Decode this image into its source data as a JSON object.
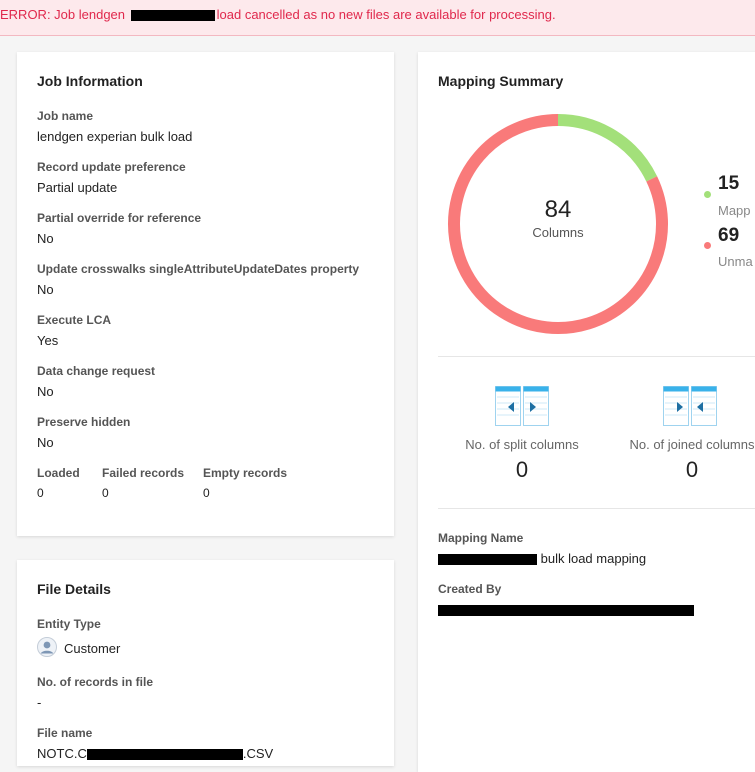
{
  "error": {
    "prefix": "ERROR: Job lendgen",
    "suffix": "load cancelled as no new files are available for processing."
  },
  "job_info": {
    "title": "Job Information",
    "fields": [
      {
        "label": "Job name",
        "value": "lendgen experian bulk load"
      },
      {
        "label": "Record update preference",
        "value": "Partial update"
      },
      {
        "label": "Partial override for reference",
        "value": "No"
      },
      {
        "label": "Update crosswalks singleAttributeUpdateDates property",
        "value": "No"
      },
      {
        "label": "Execute LCA",
        "value": "Yes"
      },
      {
        "label": "Data change request",
        "value": "No"
      },
      {
        "label": "Preserve hidden",
        "value": "No"
      }
    ],
    "counts": [
      {
        "label": "Loaded",
        "value": "0"
      },
      {
        "label": "Failed records",
        "value": "0"
      },
      {
        "label": "Empty records",
        "value": "0"
      }
    ]
  },
  "file_details": {
    "title": "File Details",
    "entity_type_label": "Entity Type",
    "entity_type_value": "Customer",
    "records_label": "No. of records in file",
    "records_value": "-",
    "file_name_label": "File name",
    "file_name_prefix": "NOTC.C",
    "file_name_suffix": ".CSV"
  },
  "mapping_summary": {
    "title": "Mapping Summary",
    "total": "84",
    "total_label": "Columns",
    "mapped": {
      "value": "15",
      "label": "Mapp",
      "color": "#a3e07a"
    },
    "unmapped": {
      "value": "69",
      "label": "Unma",
      "color": "#f97a7a"
    },
    "split_label": "No. of split columns",
    "split_value": "0",
    "joined_label": "No. of joined columns",
    "joined_value": "0",
    "mapping_name_label": "Mapping Name",
    "mapping_name_suffix": "bulk load mapping",
    "created_by_label": "Created By"
  },
  "chart_data": {
    "type": "pie",
    "categories": [
      "Mapped",
      "Unmapped"
    ],
    "values": [
      15,
      69
    ],
    "colors": [
      "#a3e07a",
      "#f97a7a"
    ],
    "title": "Mapping Summary"
  }
}
